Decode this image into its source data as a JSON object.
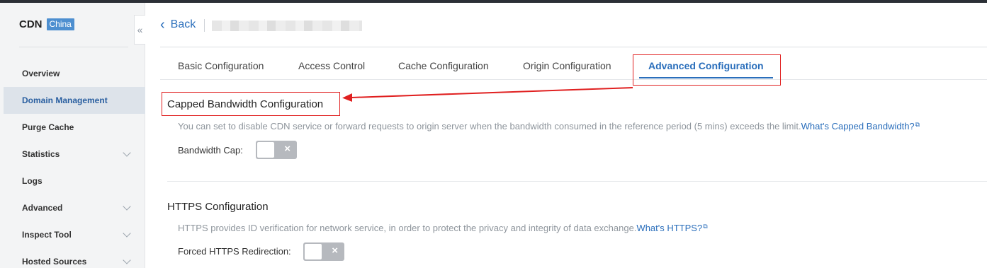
{
  "sidebar": {
    "brand": "CDN",
    "badge": "China",
    "collapse_icon": "«",
    "items": [
      {
        "label": "Overview",
        "expandable": false,
        "active": false
      },
      {
        "label": "Domain Management",
        "expandable": false,
        "active": true
      },
      {
        "label": "Purge Cache",
        "expandable": false,
        "active": false
      },
      {
        "label": "Statistics",
        "expandable": true,
        "active": false
      },
      {
        "label": "Logs",
        "expandable": false,
        "active": false
      },
      {
        "label": "Advanced",
        "expandable": true,
        "active": false
      },
      {
        "label": "Inspect Tool",
        "expandable": true,
        "active": false
      },
      {
        "label": "Hosted Sources",
        "expandable": true,
        "active": false
      }
    ]
  },
  "header": {
    "back_icon": "‹",
    "back_label": "Back"
  },
  "tabs": [
    {
      "label": "Basic Configuration",
      "active": false
    },
    {
      "label": "Access Control",
      "active": false
    },
    {
      "label": "Cache Configuration",
      "active": false
    },
    {
      "label": "Origin Configuration",
      "active": false
    },
    {
      "label": "Advanced Configuration",
      "active": true
    }
  ],
  "bandwidth": {
    "title": "Capped Bandwidth Configuration",
    "description": "You can set to disable CDN service or forward requests to origin server when the bandwidth consumed in the reference period (5 mins) exceeds the limit.",
    "link": "What's Capped Bandwidth?",
    "field_label": "Bandwidth Cap:",
    "toggle_icon": "×",
    "enabled": false
  },
  "https": {
    "title": "HTTPS Configuration",
    "description": "HTTPS provides ID verification for network service, in order to protect the privacy and integrity of data exchange.",
    "link": "What's HTTPS?",
    "field_label": "Forced HTTPS Redirection:",
    "toggle_icon": "×",
    "enabled": false
  },
  "colors": {
    "accent": "#2a6ebb",
    "annotation": "#e02020",
    "sidebar_active_bg": "#dde3ea"
  }
}
